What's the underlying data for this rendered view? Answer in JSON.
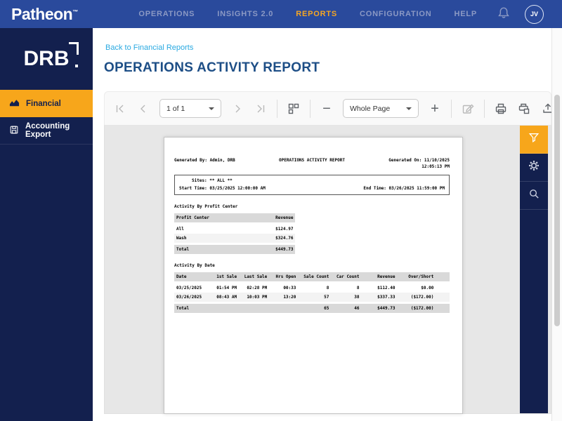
{
  "topnav": {
    "brand": "Patheon",
    "brand_tm": "™",
    "items": [
      {
        "label": "OPERATIONS",
        "active": false
      },
      {
        "label": "INSIGHTS 2.0",
        "active": false
      },
      {
        "label": "REPORTS",
        "active": true
      },
      {
        "label": "CONFIGURATION",
        "active": false
      },
      {
        "label": "HELP",
        "active": false
      }
    ],
    "avatar_initials": "JV"
  },
  "sidebar": {
    "logo_text": "DRB",
    "items": [
      {
        "label": "Financial",
        "active": true
      },
      {
        "label": "Accounting Export",
        "active": false
      }
    ]
  },
  "content": {
    "back_link": "Back to Financial Reports",
    "title": "OPERATIONS ACTIVITY REPORT"
  },
  "toolbar": {
    "page_indicator": "1 of 1",
    "zoom_level": "Whole Page",
    "zoom_out_glyph": "−",
    "zoom_in_glyph": "+"
  },
  "report": {
    "generated_by": "Generated By: Admin, DRB",
    "title": "OPERATIONS ACTIVITY REPORT",
    "generated_on_line1": "Generated On: 11/10/2025",
    "generated_on_line2": "12:05:13 PM",
    "sites_line": "Sites: ** ALL **",
    "start_time": "Start Time: 03/25/2025 12:00:00 AM",
    "end_time": "End Time: 03/26/2025 11:59:00 PM",
    "profit_section_title": "Activity By Profit Center",
    "profit_table": {
      "columns": [
        "Profit Center",
        "Revenue"
      ],
      "rows": [
        [
          "All",
          "$124.97"
        ],
        [
          "Wash",
          "$324.76"
        ]
      ],
      "total": [
        "Total",
        "$449.73"
      ]
    },
    "date_section_title": "Activity By Date",
    "date_table": {
      "columns": [
        "Date",
        "1st Sale",
        "Last Sale",
        "Hrs Open",
        "Sale Count",
        "Car Count",
        "Revenue",
        "Over/Short"
      ],
      "rows": [
        [
          "03/25/2025",
          "01:54 PM",
          "02:28 PM",
          "00:33",
          "8",
          "8",
          "$112.40",
          "$0.00"
        ],
        [
          "03/26/2025",
          "08:43 AM",
          "10:03 PM",
          "13:20",
          "57",
          "38",
          "$337.33",
          "($172.00)"
        ]
      ],
      "total": [
        "Total",
        "",
        "",
        "",
        "65",
        "46",
        "$449.73",
        "($172.00)"
      ]
    }
  },
  "colors": {
    "topnav_blue": "#2a4a9c",
    "sidebar_navy": "#13204e",
    "accent_orange": "#f7a61b",
    "nav_active_orange": "#f5a623",
    "link_blue": "#29a9e1",
    "title_blue": "#1d4e86",
    "canvas_gray": "#e7e7e7",
    "table_header_gray": "#d9d9d9"
  }
}
